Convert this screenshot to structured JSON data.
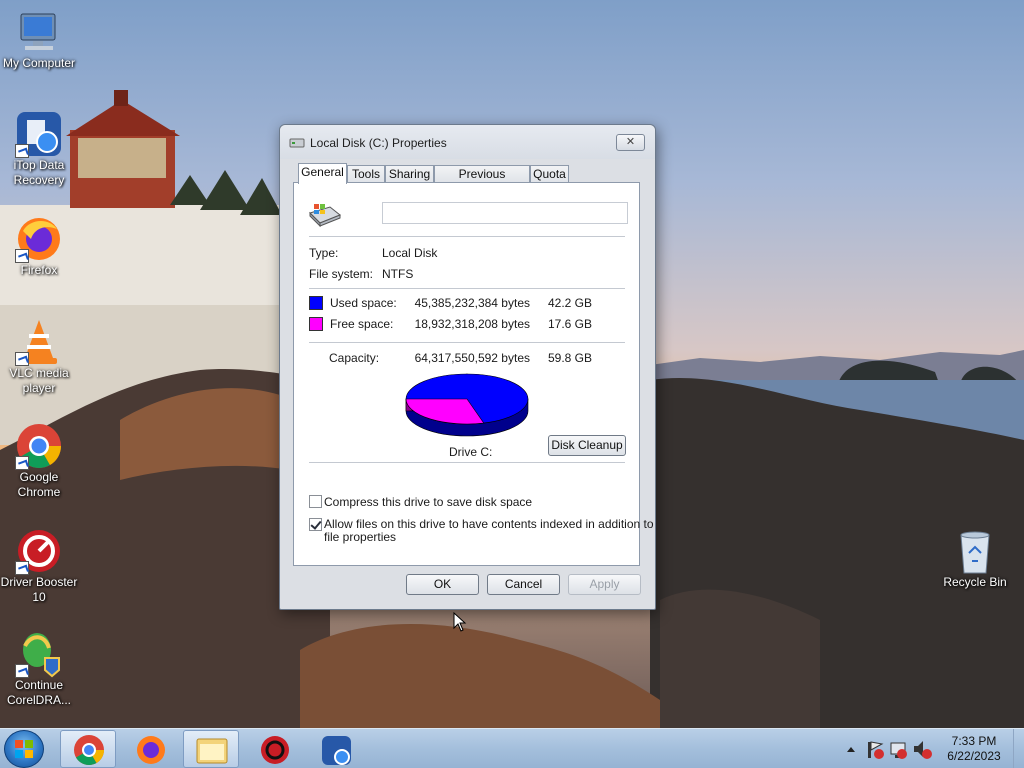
{
  "desktop": {
    "icons": [
      {
        "label": "My Computer",
        "icon": "computer-icon"
      },
      {
        "label": "iTop Data Recovery",
        "icon": "itop-data-recovery-icon"
      },
      {
        "label": "Firefox",
        "icon": "firefox-icon"
      },
      {
        "label": "VLC media player",
        "icon": "vlc-icon"
      },
      {
        "label": "Google Chrome",
        "icon": "chrome-icon"
      },
      {
        "label": "Driver Booster 10",
        "icon": "driver-booster-icon"
      },
      {
        "label": "Continue CorelDRA...",
        "icon": "coreldraw-icon"
      },
      {
        "label": "Recycle Bin",
        "icon": "recycle-bin-icon"
      }
    ]
  },
  "dialog": {
    "title": "Local Disk (C:) Properties",
    "close_label": "✕",
    "tabs": [
      {
        "label": "General",
        "active": true
      },
      {
        "label": "Tools"
      },
      {
        "label": "Sharing"
      },
      {
        "label": "Previous Versions"
      },
      {
        "label": "Quota"
      }
    ],
    "drive_name_value": "",
    "type_label": "Type:",
    "type_value": "Local Disk",
    "fs_label": "File system:",
    "fs_value": "NTFS",
    "used": {
      "label": "Used space:",
      "bytes": "45,385,232,384 bytes",
      "size": "42.2 GB",
      "color": "#0000ff"
    },
    "free": {
      "label": "Free space:",
      "bytes": "18,932,318,208 bytes",
      "size": "17.6 GB",
      "color": "#ff00ff"
    },
    "capacity": {
      "label": "Capacity:",
      "bytes": "64,317,550,592 bytes",
      "size": "59.8 GB"
    },
    "drive_label": "Drive C:",
    "disk_cleanup_label": "Disk Cleanup",
    "compress_label": "Compress this drive to save disk space",
    "compress_checked": false,
    "index_label_line1": "Allow files on this drive to have contents indexed in addition to",
    "index_label_line2": "file properties",
    "index_checked": true,
    "ok_label": "OK",
    "cancel_label": "Cancel",
    "apply_label": "Apply"
  },
  "taskbar": {
    "pinned": [
      "chrome-icon",
      "firefox-icon",
      "file-explorer-icon",
      "driver-booster-icon",
      "itop-data-recovery-icon"
    ],
    "tray_icons": [
      "show-hidden-icons-arrow",
      "action-center-flag-icon",
      "network-icon",
      "volume-muted-icon"
    ],
    "time": "7:33 PM",
    "date": "6/22/2023"
  }
}
